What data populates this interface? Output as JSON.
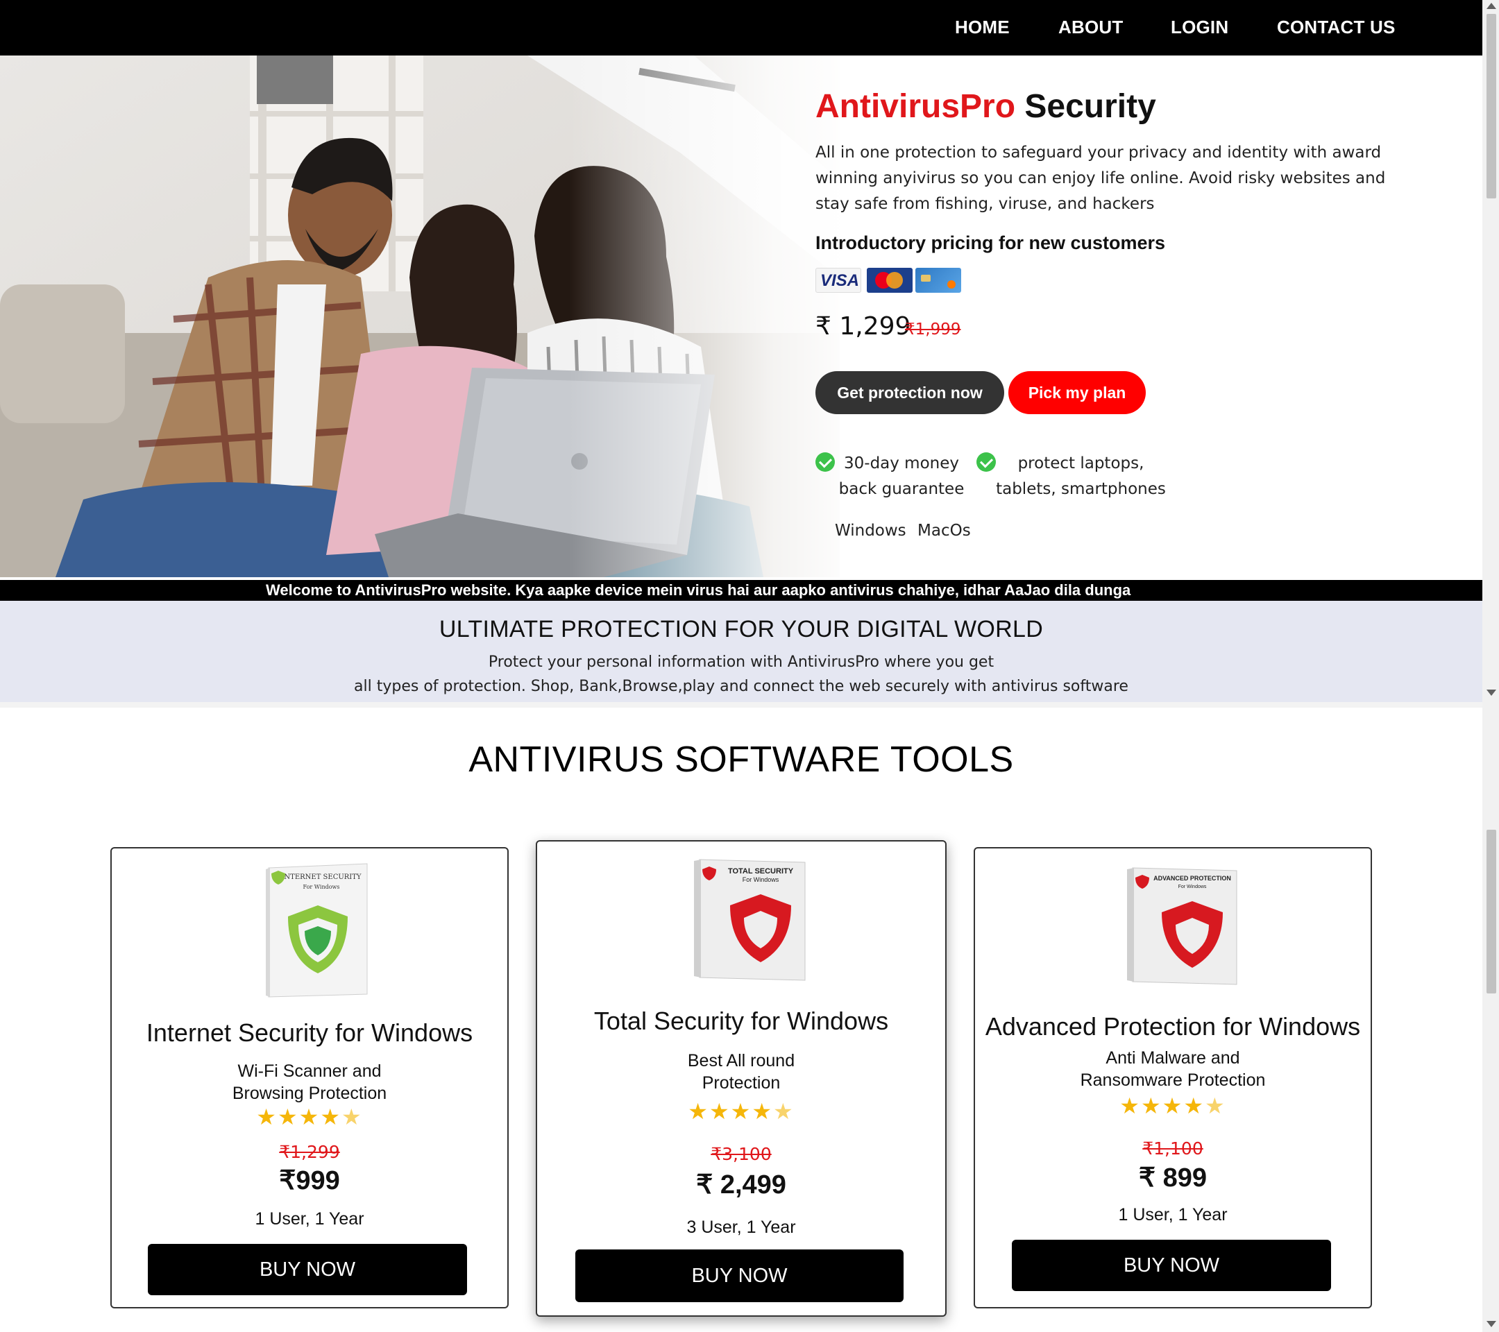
{
  "nav": {
    "items": [
      {
        "label": "HOME"
      },
      {
        "label": "ABOUT"
      },
      {
        "label": "LOGIN"
      },
      {
        "label": "CONTACT US"
      }
    ]
  },
  "hero": {
    "brand": "AntivirusPro",
    "title_rest": "Security",
    "description": "All in one protection to safeguard your privacy and identity with award winning anyivirus so you can enjoy life online. Avoid risky websites and stay safe from fishing, viruse, and hackers",
    "subheading": "Introductory pricing for new customers",
    "payment_cards": [
      "VISA",
      "Mastercard",
      "card"
    ],
    "price": "₹ 1,299",
    "old_price": "₹1,999",
    "primary_button": "Get protection now",
    "secondary_button": "Pick my plan",
    "features": [
      {
        "line1": "30-day money",
        "line2": "back guarantee"
      },
      {
        "line1": "protect laptops,",
        "line2": "tablets, smartphones"
      }
    ],
    "platforms": [
      "Windows",
      "MacOs"
    ]
  },
  "ticker": {
    "text": "Welcome to AntivirusPro website. Kya aapke device mein virus hai aur aapko antivirus chahiye, idhar AaJao dila dunga"
  },
  "band": {
    "heading": "ULTIMATE PROTECTION FOR YOUR DIGITAL WORLD",
    "line1": "Protect your personal information with AntivirusPro where you get",
    "line2": "all types of protection. Shop, Bank,Browse,play and connect the web securely with antivirus software"
  },
  "products_section": {
    "title": "ANTIVIRUS SOFTWARE TOOLS",
    "products": [
      {
        "box_title": "INTERNET SECURITY",
        "box_sub": "For Windows",
        "name": "Internet Security for Windows",
        "sub1": "Wi-Fi Scanner and",
        "sub2": "Browsing Protection",
        "rating": 4.5,
        "old_price": "₹1,299",
        "price": "₹999",
        "license": "1 User, 1 Year",
        "button": "BUY NOW",
        "shield_color": "#8cc63f"
      },
      {
        "box_title": "TOTAL SECURITY",
        "box_sub": "For Windows",
        "name": "Total Security for Windows",
        "sub1": "Best All round",
        "sub2": "Protection",
        "rating": 4.5,
        "old_price": "₹3,100",
        "price": "₹ 2,499",
        "license": "3 User, 1 Year",
        "button": "BUY NOW",
        "shield_color": "#d71920"
      },
      {
        "box_title": "ADVANCED PROTECTION",
        "box_sub": "For Windows",
        "name": "Advanced Protection for Windows",
        "sub1": "Anti Malware and",
        "sub2": "Ransomware Protection",
        "rating": 4.5,
        "old_price": "₹1,100",
        "price": "₹ 899",
        "license": "1 User, 1 Year",
        "button": "BUY NOW",
        "shield_color": "#d71920"
      }
    ]
  },
  "colors": {
    "brand_red": "#e0171b",
    "nav_bg": "#000000",
    "band_bg": "#e5e7f2",
    "check_green": "#3cc24a",
    "star": "#f5b60a"
  }
}
